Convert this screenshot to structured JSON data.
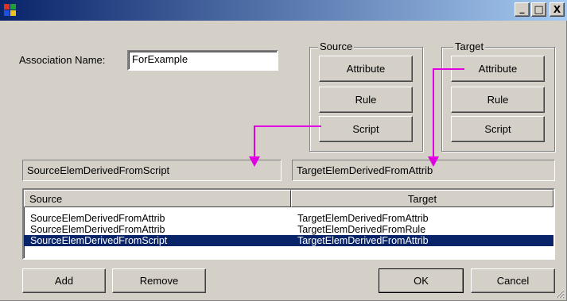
{
  "window": {
    "title": "",
    "icon": "app-window-icon",
    "controls": {
      "minimize": "_",
      "maximize": "□",
      "close": "X"
    }
  },
  "association": {
    "label": "Association Name:",
    "value": "ForExample"
  },
  "source_group": {
    "title": "Source",
    "buttons": [
      "Attribute",
      "Rule",
      "Script"
    ]
  },
  "target_group": {
    "title": "Target",
    "buttons": [
      "Attribute",
      "Rule",
      "Script"
    ]
  },
  "source_derived": "SourceElemDerivedFromScript",
  "target_derived": "TargetElemDerivedFromAttrib",
  "list": {
    "columns": [
      "Source",
      "Target"
    ],
    "rows": [
      {
        "source": "SourceElemDerivedFromAttrib",
        "target": "TargetElemDerivedFromAttrib",
        "selected": false
      },
      {
        "source": "SourceElemDerivedFromAttrib",
        "target": "TargetElemDerivedFromRule",
        "selected": false
      },
      {
        "source": "SourceElemDerivedFromScript",
        "target": "TargetElemDerivedFromAttrib",
        "selected": true
      }
    ]
  },
  "buttons": {
    "add": "Add",
    "remove": "Remove",
    "ok": "OK",
    "cancel": "Cancel"
  },
  "colors": {
    "titlebar_start": "#0a246a",
    "titlebar_end": "#a6caf0",
    "arrow": "#e100e1",
    "selection": "#0a246a"
  }
}
